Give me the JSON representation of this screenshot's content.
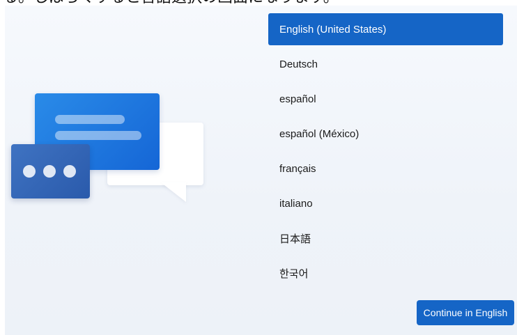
{
  "caption": "る。しばらくすると言語選択の画面になります。",
  "languages": [
    {
      "label": "English (United States)",
      "selected": true
    },
    {
      "label": "Deutsch",
      "selected": false
    },
    {
      "label": "español",
      "selected": false
    },
    {
      "label": "español (México)",
      "selected": false
    },
    {
      "label": "français",
      "selected": false
    },
    {
      "label": "italiano",
      "selected": false
    },
    {
      "label": "日本語",
      "selected": false
    },
    {
      "label": "한국어",
      "selected": false
    }
  ],
  "continue_button": {
    "label": "Continue in English"
  },
  "illustration": {
    "icon": "chat-bubbles-icon",
    "accent": "#1565c6"
  }
}
